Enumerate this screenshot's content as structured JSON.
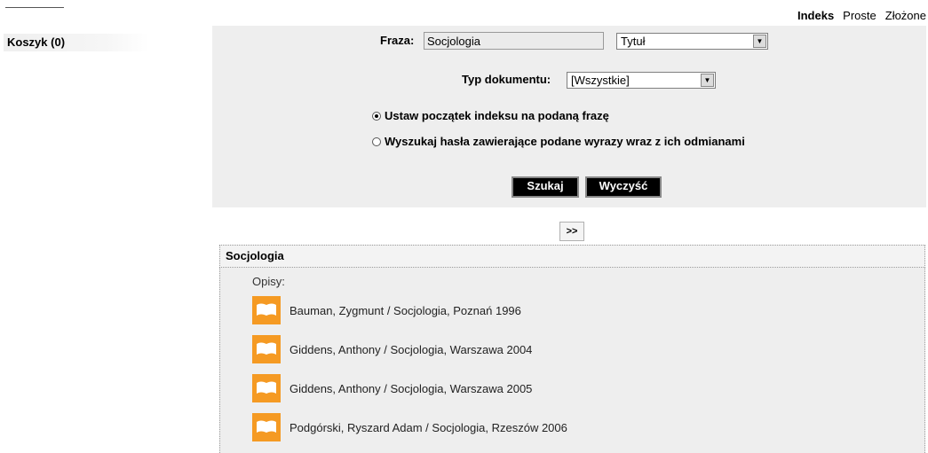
{
  "tabs": [
    {
      "label": "Indeks",
      "active": true
    },
    {
      "label": "Proste",
      "active": false
    },
    {
      "label": "Złożone",
      "active": false
    }
  ],
  "cart": {
    "label": "Koszyk (0)"
  },
  "search": {
    "phrase_label": "Fraza:",
    "phrase_value": "Socjologia",
    "field_select_value": "Tytuł",
    "doctype_label": "Typ dokumentu:",
    "doctype_select_value": "[Wszystkie]",
    "radio_index_label": "Ustaw początek indeksu na podaną frazę",
    "radio_words_label": "Wyszukaj hasła zawierające podane wyrazy wraz z ich odmianami",
    "search_button": "Szukaj",
    "clear_button": "Wyczyść"
  },
  "pager": {
    "next_label": ">>"
  },
  "results": {
    "heading": "Socjologia",
    "section_label": "Opisy:",
    "items": [
      "Bauman, Zygmunt / Socjologia, Poznań 1996",
      "Giddens, Anthony / Socjologia, Warszawa 2004",
      "Giddens, Anthony / Socjologia, Warszawa 2005",
      "Podgórski, Ryszard Adam / Socjologia, Rzeszów 2006"
    ]
  },
  "colors": {
    "accent_icon": "#f59a23",
    "panel_bg": "#eeeeee",
    "button_bg": "#000000"
  }
}
